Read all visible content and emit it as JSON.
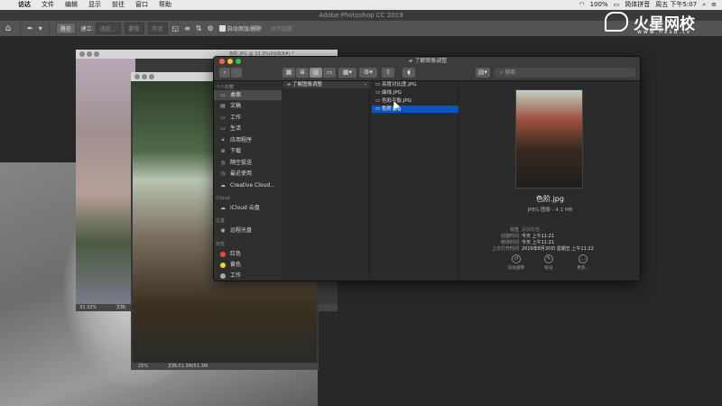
{
  "menubar": {
    "apple": "",
    "items": [
      "访达",
      "文件",
      "编辑",
      "显示",
      "前往",
      "窗口",
      "帮助"
    ],
    "right": {
      "battery": "100%",
      "input": "简体拼音",
      "clock": "周五 下午5:07"
    }
  },
  "photoshop": {
    "title": "Adobe Photoshop CC 2019",
    "options": {
      "home_icon": "home-icon",
      "path_mode": "路径",
      "make_label": "建立:",
      "selection_btn": "选区...",
      "mask_btn": "蒙版",
      "shape_btn": "形状",
      "auto_add_delete": "自动添加/删除",
      "align_edges": "对齐边缘"
    },
    "doc1": {
      "title": "色阶.JPG @ 33.3%(RGB/8#) *",
      "zoom": "33.33%",
      "doc_info": "文档:"
    },
    "doc2": {
      "zoom": "25%",
      "doc_info": "文档:51.3M/51.3M"
    }
  },
  "watermark": {
    "brand": "火星网校",
    "site": "www.hxsd.tv"
  },
  "finder": {
    "title": "了解图像调整",
    "search_placeholder": "搜索",
    "sidebar": {
      "favorites_header": "个人收藏",
      "favorites": [
        {
          "label": "桌面",
          "icon": "desktop-icon",
          "selected": true
        },
        {
          "label": "文稿",
          "icon": "documents-icon"
        },
        {
          "label": "工作",
          "icon": "folder-icon"
        },
        {
          "label": "生活",
          "icon": "folder-icon"
        },
        {
          "label": "应用程序",
          "icon": "applications-icon"
        },
        {
          "label": "下载",
          "icon": "download-icon"
        },
        {
          "label": "隔空投送",
          "icon": "airdrop-icon"
        },
        {
          "label": "最近使用",
          "icon": "recents-icon"
        },
        {
          "label": "Creative Cloud...",
          "icon": "creative-cloud-icon"
        }
      ],
      "icloud_header": "iCloud",
      "icloud": [
        {
          "label": "iCloud 云盘",
          "icon": "cloud-icon"
        }
      ],
      "locations_header": "位置",
      "locations": [
        {
          "label": "远程光盘",
          "icon": "disc-icon"
        }
      ],
      "tags_header": "标签",
      "tags": [
        {
          "label": "红色",
          "color": "#f04545"
        },
        {
          "label": "黄色",
          "color": "#f5d22b"
        },
        {
          "label": "工作",
          "color": "#aaaaaa"
        }
      ]
    },
    "column1": [
      {
        "label": "了解图像调整",
        "icon": "folder-icon"
      }
    ],
    "column2": [
      {
        "label": "亮度对比度.JPG"
      },
      {
        "label": "曲线.JPG"
      },
      {
        "label": "色彩平衡.JPG"
      },
      {
        "label": "色阶.jpg",
        "selected": true
      }
    ],
    "preview": {
      "filename": "色阶.jpg",
      "kind": "JPEG 图像 - 4.1 MB",
      "meta": [
        {
          "k": "标签",
          "v": "添加标签...",
          "placeholder": true
        },
        {
          "k": "创建时间",
          "v": "今天 上午11:21"
        },
        {
          "k": "修改时间",
          "v": "今天 上午11:21"
        },
        {
          "k": "上次打开时间",
          "v": "2019年8月30日 星期五 上午11:22"
        }
      ],
      "actions": [
        {
          "label": "向左旋转",
          "icon": "rotate-left-icon"
        },
        {
          "label": "标记",
          "icon": "markup-icon"
        },
        {
          "label": "更多...",
          "icon": "more-icon"
        }
      ]
    }
  }
}
